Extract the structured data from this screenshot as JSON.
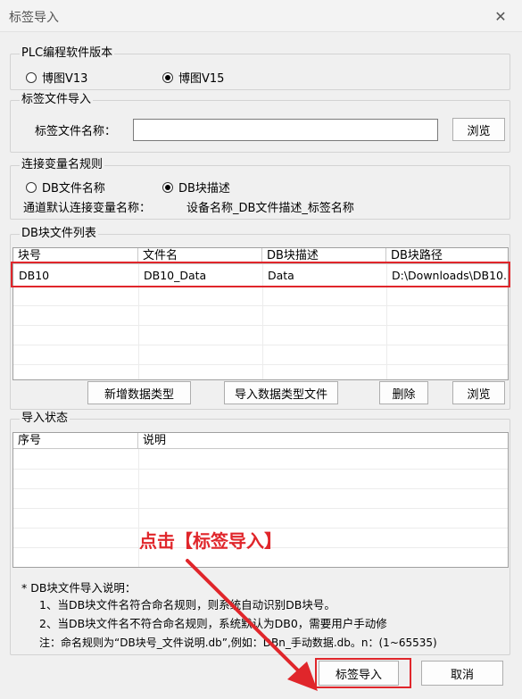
{
  "window": {
    "title": "标签导入",
    "close_glyph": "✕"
  },
  "plc_version": {
    "legend": "PLC编程软件版本",
    "options": [
      {
        "label": "博图V13",
        "checked": false
      },
      {
        "label": "博图V15",
        "checked": true
      }
    ]
  },
  "tag_file": {
    "legend": "标签文件导入",
    "name_label": "标签文件名称：",
    "name_value": "",
    "browse_label": "浏览"
  },
  "connect_rule": {
    "legend": "连接变量名规则",
    "options": [
      {
        "label": "DB文件名称",
        "checked": false
      },
      {
        "label": "DB块描述",
        "checked": true
      }
    ],
    "default_label": "通道默认连接变量名称：",
    "default_value": "设备名称_DB文件描述_标签名称"
  },
  "db_list": {
    "legend": "DB块文件列表",
    "columns": [
      "块号",
      "文件名",
      "DB块描述",
      "DB块路径"
    ],
    "rows": [
      {
        "block": "DB10",
        "file": "DB10_Data",
        "desc": "Data",
        "path": "D:\\Downloads\\DB10..."
      }
    ],
    "buttons": {
      "add_type": "新增数据类型",
      "import_type": "导入数据类型文件",
      "delete": "删除",
      "browse": "浏览"
    }
  },
  "import_status": {
    "legend": "导入状态",
    "columns": [
      "序号",
      "说明"
    ]
  },
  "annotation": "点击【标签导入】",
  "notes": {
    "title": "* DB块文件导入说明：",
    "line1": "1、当DB块文件名符合命名规则，则系统自动识别DB块号。",
    "line2": "2、当DB块文件名不符合命名规则，系统默认为DB0，需要用户手动修",
    "line3": "注：命名规则为“DB块号_文件说明.db”,例如：DBn_手动数据.db。n：(1~65535)"
  },
  "footer": {
    "import_label": "标签导入",
    "cancel_label": "取消"
  },
  "colors": {
    "highlight": "#e0262b"
  }
}
